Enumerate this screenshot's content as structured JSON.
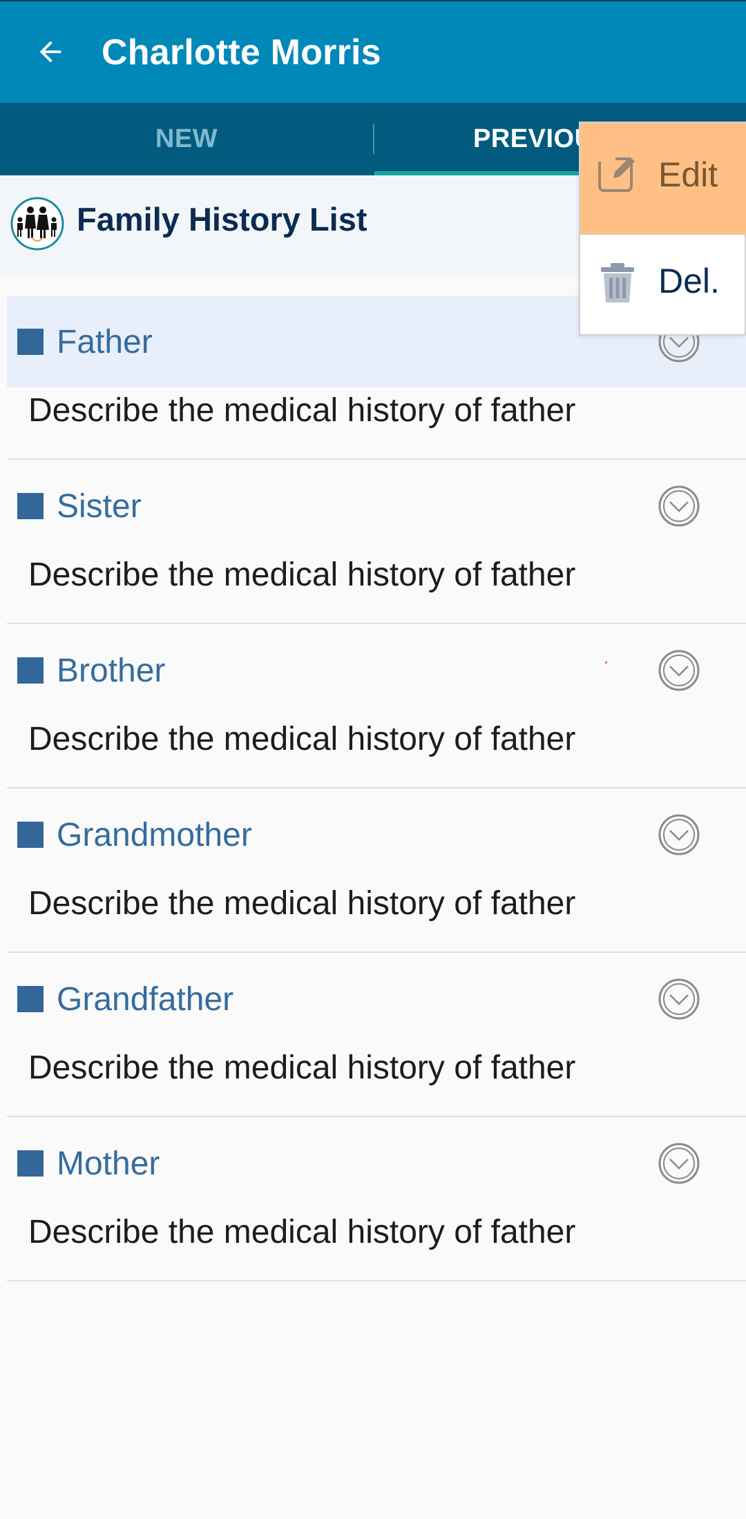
{
  "app_bar": {
    "title": "Charlotte Morris",
    "back_icon": "arrow-left-icon"
  },
  "tabs": [
    {
      "label": "NEW",
      "active": false
    },
    {
      "label": "PREVIOU",
      "active": true
    }
  ],
  "section": {
    "title": "Family History List",
    "logo_icon": "family-logo-icon"
  },
  "rows": [
    {
      "title": "Father",
      "description": "Describe the medical history of father",
      "selected": true
    },
    {
      "title": "Sister",
      "description": "Describe the medical history of father",
      "selected": false
    },
    {
      "title": "Brother",
      "description": "Describe the medical history of father",
      "selected": false
    },
    {
      "title": "Grandmother",
      "description": "Describe the medical history of father",
      "selected": false
    },
    {
      "title": "Grandfather",
      "description": "Describe the medical history of father",
      "selected": false
    },
    {
      "title": "Mother",
      "description": "Describe the medical history of father",
      "selected": false
    }
  ],
  "popup_menu": {
    "edit_label": "Edit",
    "edit_icon": "edit-icon",
    "delete_label": "Del.",
    "delete_icon": "trash-icon"
  },
  "colors": {
    "app_bar": "#0088b8",
    "tab_bar": "#025b7e",
    "tab_indicator": "#17a6a0",
    "row_title": "#356c9e",
    "bullet": "#336699",
    "selected_row": "#e8effb",
    "edit_highlight": "#ffc085"
  }
}
